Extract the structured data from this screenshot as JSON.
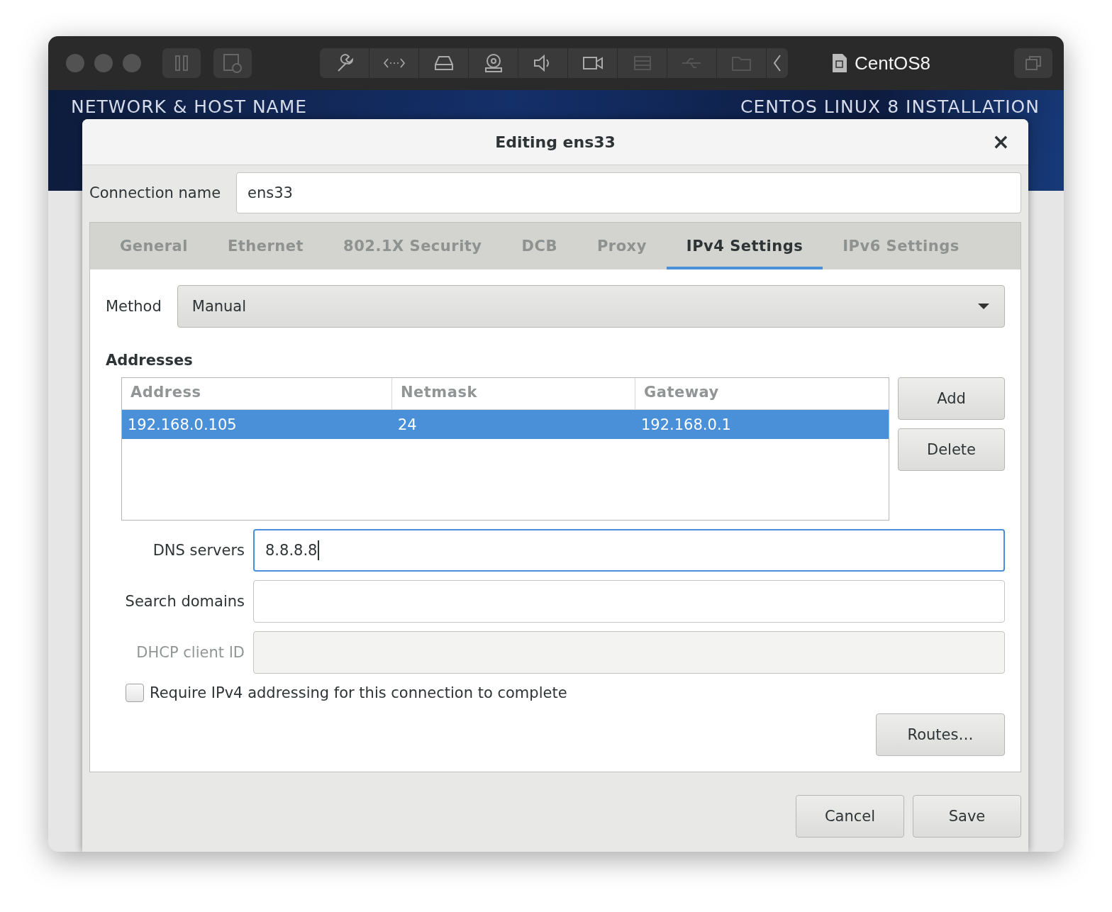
{
  "vm_window": {
    "title": "CentOS8"
  },
  "installer": {
    "section_title": "NETWORK & HOST NAME",
    "product_title": "CENTOS LINUX 8 INSTALLATION"
  },
  "dialog": {
    "title": "Editing ens33",
    "close": "×"
  },
  "connection_name": {
    "label": "Connection name",
    "value": "ens33"
  },
  "tabs": [
    {
      "label": "General",
      "selected": false
    },
    {
      "label": "Ethernet",
      "selected": false
    },
    {
      "label": "802.1X Security",
      "selected": false
    },
    {
      "label": "DCB",
      "selected": false
    },
    {
      "label": "Proxy",
      "selected": false
    },
    {
      "label": "IPv4 Settings",
      "selected": true
    },
    {
      "label": "IPv6 Settings",
      "selected": false
    }
  ],
  "method": {
    "label": "Method",
    "value": "Manual"
  },
  "addresses": {
    "heading": "Addresses",
    "columns": [
      "Address",
      "Netmask",
      "Gateway"
    ],
    "rows": [
      {
        "cells": [
          "192.168.0.105",
          "24",
          "192.168.0.1"
        ],
        "selected": true
      }
    ],
    "buttons": [
      "Add",
      "Delete"
    ]
  },
  "fields": [
    {
      "label": "DNS servers",
      "value": "8.8.8.8",
      "focused": true,
      "disabled": false
    },
    {
      "label": "Search domains",
      "focused": false,
      "disabled": false
    },
    {
      "label": "DHCP client ID",
      "focused": false,
      "disabled": true
    }
  ],
  "require_checkbox": {
    "label": "Require IPv4 addressing for this connection to complete",
    "checked": false
  },
  "routes_button": "Routes…",
  "footer_buttons": [
    "Cancel",
    "Save"
  ]
}
